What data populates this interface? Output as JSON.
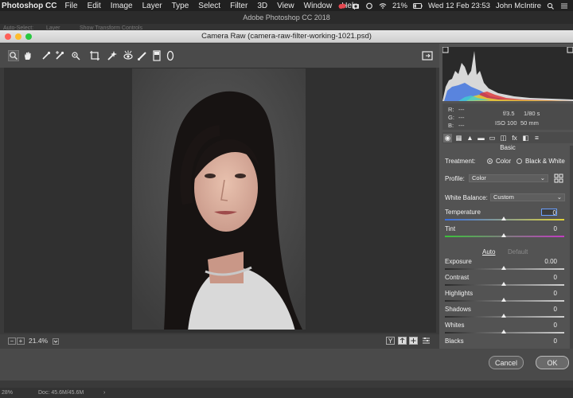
{
  "menubar": {
    "app": "Photoshop CC",
    "items": [
      "File",
      "Edit",
      "Image",
      "Layer",
      "Type",
      "Select",
      "Filter",
      "3D",
      "View",
      "Window",
      "Help"
    ],
    "battery": "21%",
    "datetime": "Wed 12 Feb  23:53",
    "user": "John McIntire"
  },
  "ps_title": "Adobe Photoshop CC 2018",
  "ps_options_ghost": [
    "Auto-Select:",
    "Layer",
    "Show Transform Controls"
  ],
  "dialog": {
    "title": "Camera Raw (camera-raw-filter-working-1021.psd)",
    "zoom": "21.4%",
    "cancel": "Cancel",
    "ok": "OK"
  },
  "readout": {
    "r_label": "R:",
    "r_val": "---",
    "g_label": "G:",
    "g_val": "---",
    "b_label": "B:",
    "b_val": "---",
    "aperture": "f/3.5",
    "shutter": "1/80 s",
    "iso": "ISO 100",
    "focal": "50 mm"
  },
  "basic": {
    "title": "Basic",
    "treatment_label": "Treatment:",
    "color_option": "Color",
    "bw_option": "Black & White",
    "profile_label": "Profile:",
    "profile_value": "Color",
    "wb_label": "White Balance:",
    "wb_value": "Custom",
    "auto": "Auto",
    "default": "Default",
    "sliders": [
      {
        "label": "Temperature",
        "value": "0"
      },
      {
        "label": "Tint",
        "value": "0"
      },
      {
        "label": "Exposure",
        "value": "0.00"
      },
      {
        "label": "Contrast",
        "value": "0"
      },
      {
        "label": "Highlights",
        "value": "0"
      },
      {
        "label": "Shadows",
        "value": "0"
      },
      {
        "label": "Whites",
        "value": "0"
      },
      {
        "label": "Blacks",
        "value": "0"
      }
    ]
  },
  "statusbar": {
    "zoom": "28%",
    "doc": "Doc: 45.6M/45.6M"
  },
  "colors": {
    "accent": "#2f7fe8",
    "panel": "#535353"
  }
}
